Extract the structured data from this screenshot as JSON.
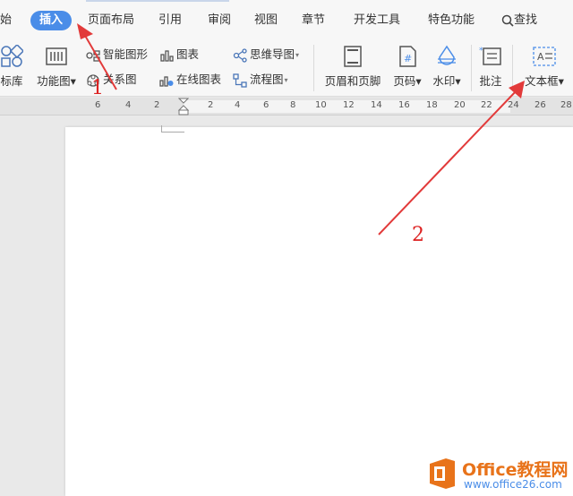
{
  "menu": {
    "items": [
      "开始",
      "插入",
      "页面布局",
      "引用",
      "审阅",
      "视图",
      "章节",
      "开发工具",
      "特色功能"
    ],
    "partial_first": "始",
    "search_label": "查找",
    "active_index": 1
  },
  "ribbon": {
    "col1": {
      "label": "标库"
    },
    "col2": {
      "label": "功能图"
    },
    "col3": {
      "smart_art": "智能图形",
      "relation": "关系图"
    },
    "col4": {
      "chart": "图表",
      "online_chart": "在线图表"
    },
    "col5": {
      "mind_map": "思维导图",
      "flow_chart": "流程图"
    },
    "col6": {
      "header_footer": "页眉和页脚"
    },
    "col7": {
      "page_number": "页码"
    },
    "col8": {
      "watermark": "水印"
    },
    "col9": {
      "comment": "批注"
    },
    "col10": {
      "text_box": "文本框"
    }
  },
  "ruler": {
    "ticks": [
      "6",
      "4",
      "2",
      "2",
      "4",
      "6",
      "8",
      "10",
      "12",
      "14",
      "16",
      "18",
      "20",
      "22",
      "24",
      "26",
      "28"
    ]
  },
  "annotations": {
    "step1": "1",
    "step2": "2",
    "arrow_color": "#e23a3a"
  },
  "watermark": {
    "brand": "Office教程网",
    "url": "www.office26.com"
  },
  "colors": {
    "accent": "#4a8de8",
    "logo_orange": "#e8731a"
  }
}
